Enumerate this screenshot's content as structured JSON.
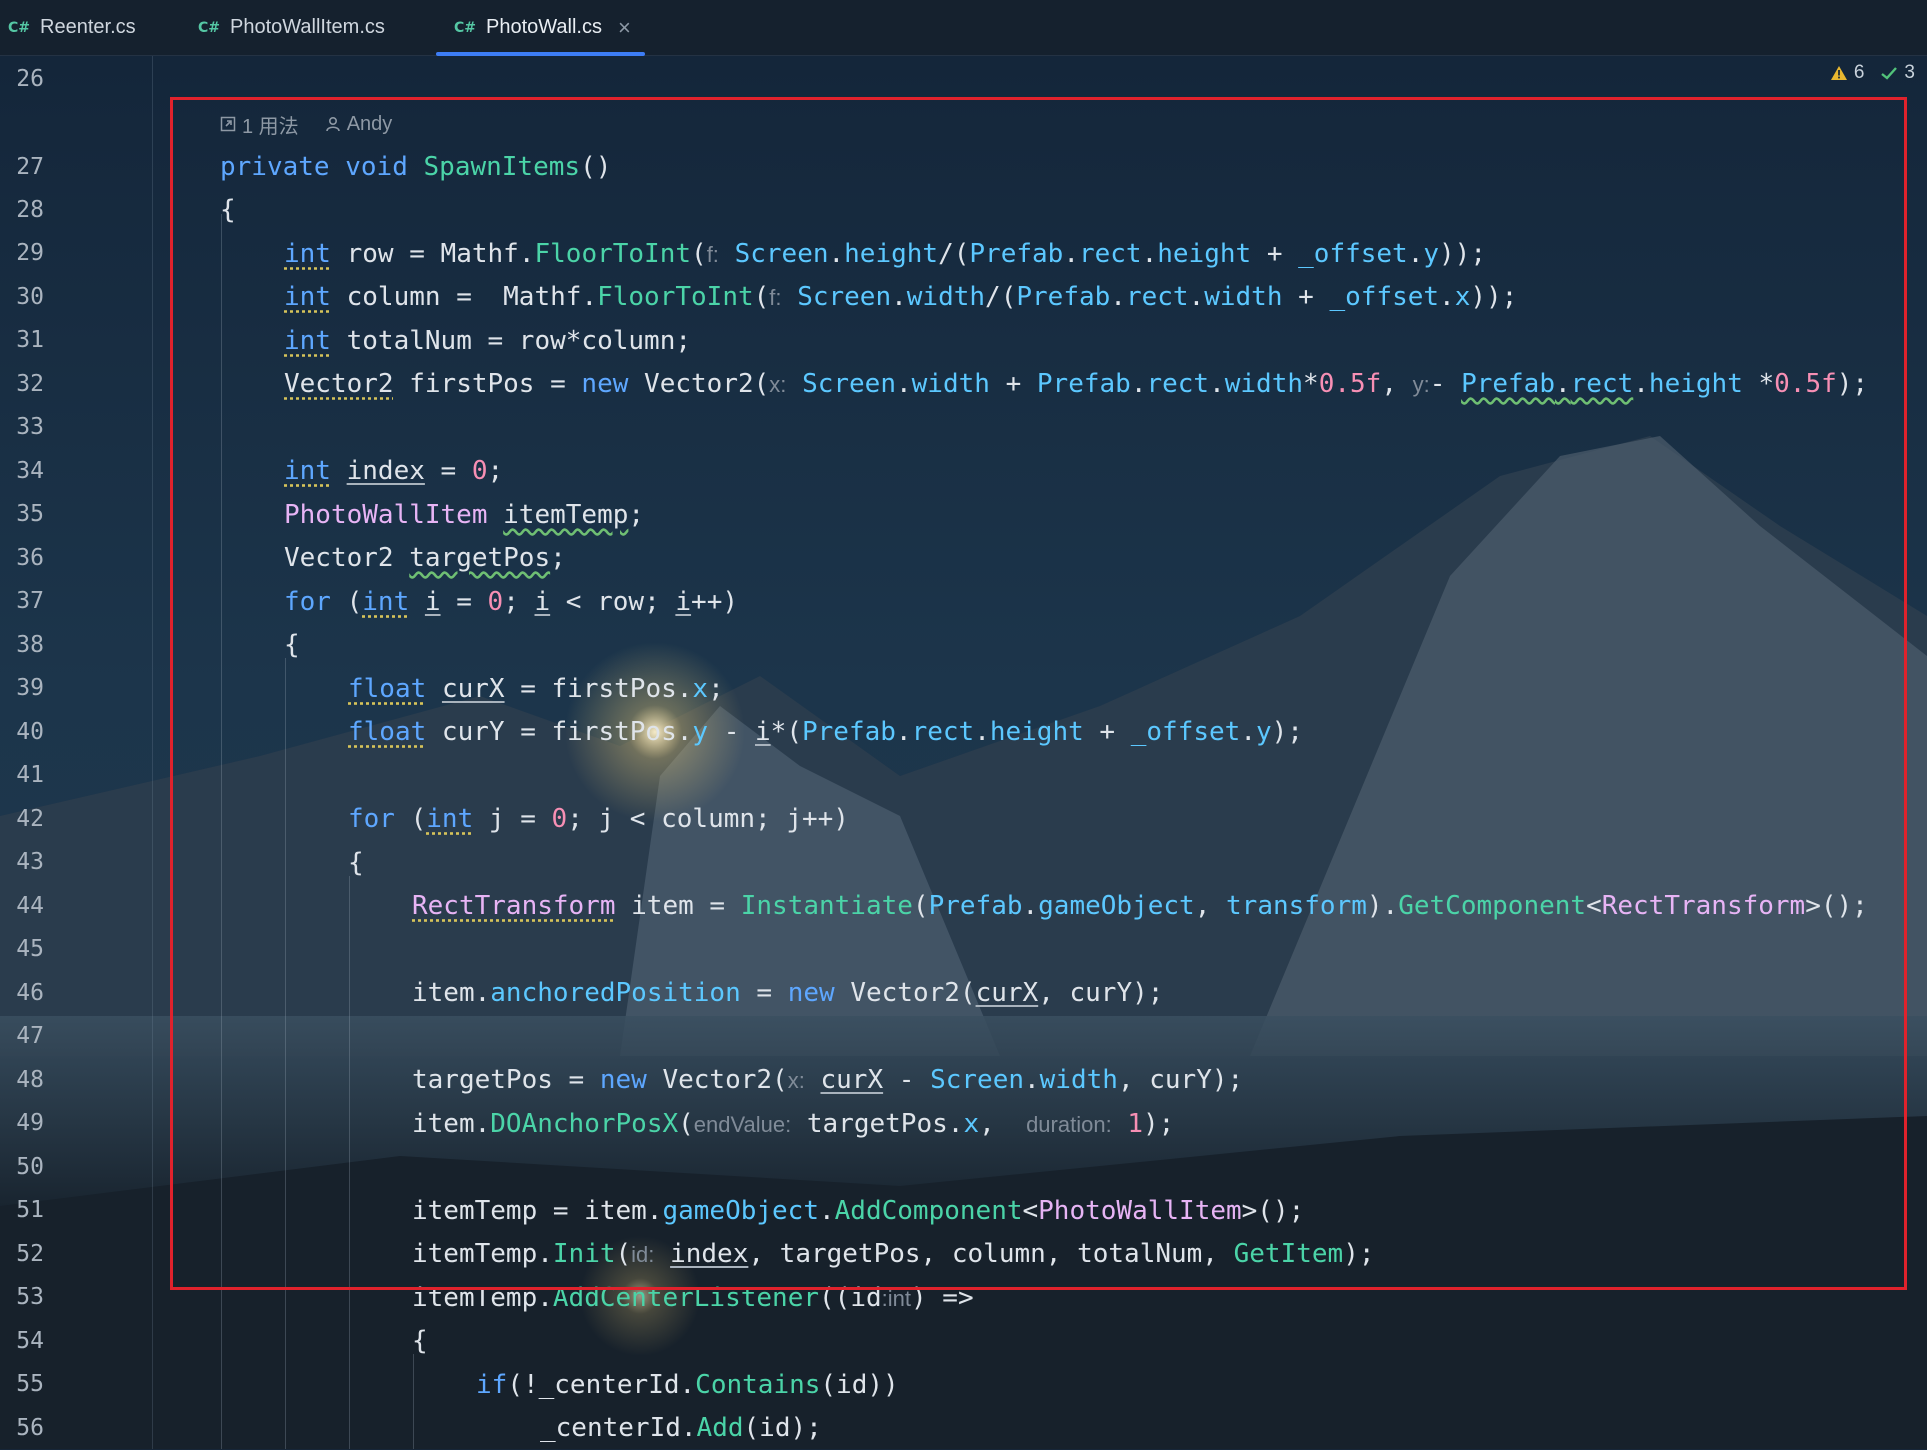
{
  "tabs": [
    {
      "icon": "C#",
      "label": "Reenter.cs",
      "active": false
    },
    {
      "icon": "C#",
      "label": "PhotoWallItem.cs",
      "active": false
    },
    {
      "icon": "C#",
      "label": "PhotoWall.cs",
      "active": true,
      "close": "×"
    }
  ],
  "status": {
    "warnings": "6",
    "checks": "3"
  },
  "codelens": {
    "usages": "1 用法",
    "author": "Andy"
  },
  "line_numbers": [
    "26",
    "27",
    "28",
    "29",
    "30",
    "31",
    "32",
    "33",
    "34",
    "35",
    "36",
    "37",
    "38",
    "39",
    "40",
    "41",
    "42",
    "43",
    "44",
    "45",
    "46",
    "47",
    "48",
    "49",
    "50",
    "51",
    "52",
    "53",
    "54",
    "55",
    "56"
  ],
  "code_tokens": {
    "l27": [
      "private",
      "void",
      "SpawnItems",
      "()"
    ],
    "l28": [
      "{"
    ],
    "l29": [
      "int",
      " row = ",
      "Mathf",
      ".",
      "FloorToInt",
      "(",
      "f:",
      "Screen",
      ".",
      "height",
      "/(",
      "Prefab",
      ".",
      "rect",
      ".",
      "height",
      " + ",
      "_offset",
      ".",
      "y",
      "));"
    ],
    "l30": [
      "int",
      " column =  ",
      "Mathf",
      ".",
      "FloorToInt",
      "(",
      "f:",
      "Screen",
      ".",
      "width",
      "/(",
      "Prefab",
      ".",
      "rect",
      ".",
      "width",
      " + ",
      "_offset",
      ".",
      "x",
      "));"
    ],
    "l31": [
      "int",
      " totalNum = row*column;"
    ],
    "l32": [
      "Vector2",
      " firstPos = ",
      "new",
      " ",
      "Vector2",
      "(",
      "x:",
      "Screen",
      ".",
      "width",
      " + ",
      "Prefab",
      ".",
      "rect",
      ".",
      "width",
      "*",
      "0.5f",
      ",",
      "y:",
      "- ",
      "Prefab",
      ".",
      "rect",
      ".",
      "height",
      " *",
      "0.5f",
      ");"
    ],
    "l34": [
      "int",
      " ",
      "index",
      " = ",
      "0",
      ";"
    ],
    "l35": [
      "PhotoWallItem",
      " ",
      "itemTemp",
      ";"
    ],
    "l36": [
      "Vector2",
      " ",
      "targetPos",
      ";"
    ],
    "l37": [
      "for",
      " (",
      "int",
      " ",
      "i",
      " = ",
      "0",
      "; ",
      "i",
      " < row; ",
      "i",
      "++)"
    ],
    "l38": [
      "{"
    ],
    "l39": [
      "float",
      " ",
      "curX",
      " = firstPos.",
      "x",
      ";"
    ],
    "l40": [
      "float",
      " curY = firstPos.",
      "y",
      " - ",
      "i",
      "*(",
      "Prefab",
      ".",
      "rect",
      ".",
      "height",
      " + ",
      "_offset",
      ".",
      "y",
      ");"
    ],
    "l42": [
      "for",
      " (",
      "int",
      " j = ",
      "0",
      "; j < column; j++)"
    ],
    "l43": [
      "{"
    ],
    "l44": [
      "RectTransform",
      " item = ",
      "Instantiate",
      "(",
      "Prefab",
      ".",
      "gameObject",
      ", ",
      "transform",
      ").",
      "GetComponent",
      "<",
      "RectTransform",
      ">();"
    ],
    "l46": [
      "item.",
      "anchoredPosition",
      " = ",
      "new",
      " ",
      "Vector2",
      "(",
      "curX",
      ", curY);"
    ],
    "l48": [
      "targetPos = ",
      "new",
      " ",
      "Vector2",
      "(",
      "x:",
      "curX",
      " - ",
      "Screen",
      ".",
      "width",
      ", curY);"
    ],
    "l49": [
      "item.",
      "DOAnchorPosX",
      "(",
      "endValue:",
      "targetPos.",
      "x",
      ", ",
      "duration:",
      "1",
      ");"
    ],
    "l51": [
      "itemTemp = item.",
      "gameObject",
      ".",
      "AddComponent",
      "<",
      "PhotoWallItem",
      ">();"
    ],
    "l52": [
      "itemTemp.",
      "Init",
      "(",
      "id:",
      "index",
      ", targetPos, column, totalNum, ",
      "GetItem",
      ");"
    ],
    "l53": [
      "itemTemp.",
      "AddCenterListener",
      "((",
      "id",
      ":int",
      ") =>"
    ],
    "l54": [
      "{"
    ],
    "l55": [
      "if",
      "(!",
      "_centerId",
      ".",
      "Contains",
      "(id))"
    ],
    "l56": [
      "_centerId",
      ".",
      "Add",
      "(id);"
    ]
  },
  "colors": {
    "keyword": "#5ea7ff",
    "type": "#e7b4f5",
    "method": "#4bd4a8",
    "property": "#5cc8ff",
    "number": "#f78fb4",
    "highlight_box": "#e0222c",
    "tab_underline": "#3d7df5"
  }
}
